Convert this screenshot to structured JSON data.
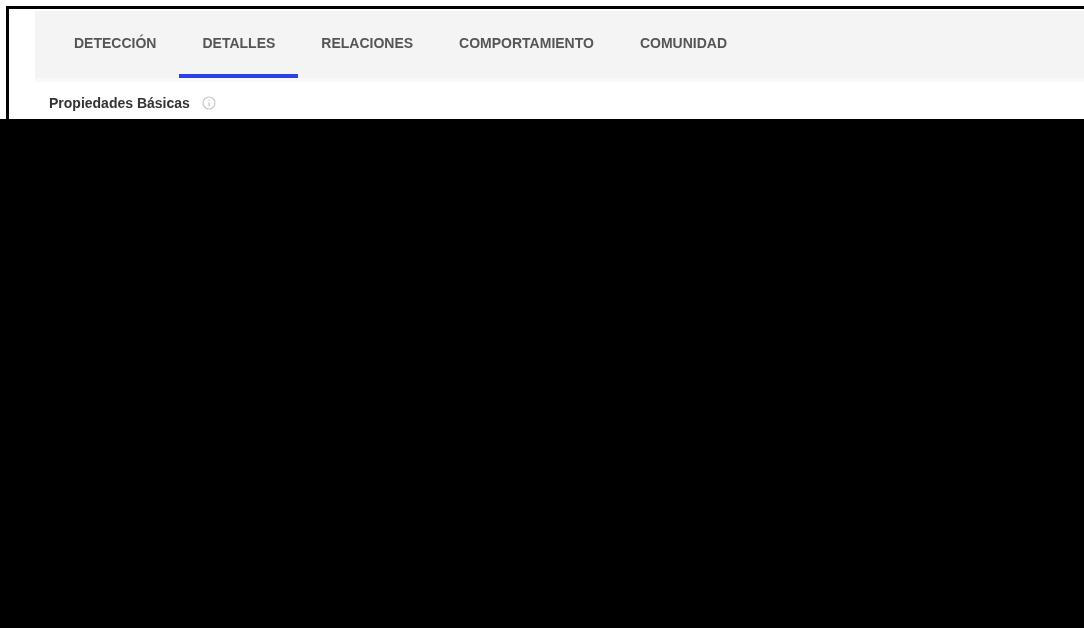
{
  "tabs": [
    {
      "label": "DETECCIÓN",
      "selected": false
    },
    {
      "label": "DETALLES",
      "selected": true
    },
    {
      "label": "RELACIONES",
      "selected": false
    },
    {
      "label": "COMPORTAMIENTO",
      "selected": false
    },
    {
      "label": "COMUNIDAD",
      "selected": false
    }
  ],
  "section": {
    "title": "Propiedades Básicas"
  }
}
